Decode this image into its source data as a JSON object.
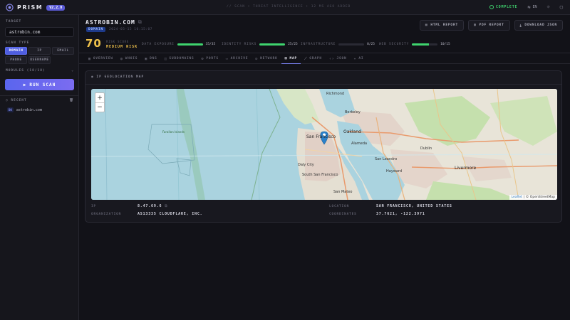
{
  "topbar": {
    "brand": "PRISM",
    "version": "V2.2.0",
    "center_text": "// SCAN • THREAT INTELLIGENCE • 12 MS AGO ADDED",
    "status": "COMPLETE",
    "lang": "EN"
  },
  "sidebar": {
    "target_label": "TARGET",
    "target_value": "astrobin.com",
    "scan_type_label": "SCAN TYPE",
    "scan_types": [
      "DOMAIN",
      "IP",
      "EMAIL",
      "PHONE",
      "USERNAME"
    ],
    "modules_label": "MODULES (18/18)",
    "run_label": "RUN SCAN",
    "recent_label": "RECENT",
    "recent": [
      {
        "tag": "DO",
        "label": "astrobin.com"
      }
    ]
  },
  "header": {
    "title": "ASTROBIN.COM",
    "badge": "DOMAIN",
    "timestamp": "2024-05-15 10:15:07",
    "score": "70",
    "score_label": "RISK SCORE",
    "risk_label": "MEDIUM RISK",
    "metrics": [
      {
        "label": "DATA EXPOSURE",
        "value": "35/35",
        "percent": 100,
        "dim": false
      },
      {
        "label": "IDENTITY RISKS",
        "value": "25/25",
        "percent": 100,
        "dim": false
      },
      {
        "label": "INFRASTRUCTURE",
        "value": "0/25",
        "percent": 0,
        "dim": true
      },
      {
        "label": "WEB SECURITY",
        "value": "10/15",
        "percent": 67,
        "dim": false
      }
    ],
    "buttons": {
      "html": "HTML REPORT",
      "pdf": "PDF REPORT",
      "json": "DOWNLOAD JSON"
    }
  },
  "tabs": [
    "OVERVIEW",
    "WHOIS",
    "DNS",
    "SUBDOMAINS",
    "PORTS",
    "ARCHIVE",
    "NETWORK",
    "MAP",
    "GRAPH",
    "JSON",
    "AI"
  ],
  "active_tab": "MAP",
  "panel": {
    "title": "IP GEOLOCATION MAP",
    "map_labels": {
      "richmond": "Richmond",
      "berkeley": "Berkeley",
      "oakland": "Oakland",
      "alameda": "Alameda",
      "sanfrancisco": "San Francisco",
      "dalycity": "Daly City",
      "southsf": "South San Francisco",
      "sanleandro": "San Leandro",
      "hayward": "Hayward",
      "livermore": "Livermore",
      "dublin": "Dublin",
      "sanmateo": "San Mateo",
      "farallon": "Farallon Islands"
    },
    "attribution_leaflet": "Leaflet",
    "attribution_osm": "| © OpenStreetMap",
    "ip_label": "IP",
    "ip_value": "8.47.69.6",
    "org_label": "ORGANIZATION",
    "org_value": "AS13335 CLOUDFLARE, INC.",
    "location_label": "LOCATION",
    "location_value": "SAN FRANCISCO, UNITED STATES",
    "coords_label": "COORDINATES",
    "coords_value": "37.7621, -122.3971"
  },
  "colors": {
    "accent": "#5b5bd6",
    "success": "#3fd46e",
    "warning": "#f0c24b"
  }
}
